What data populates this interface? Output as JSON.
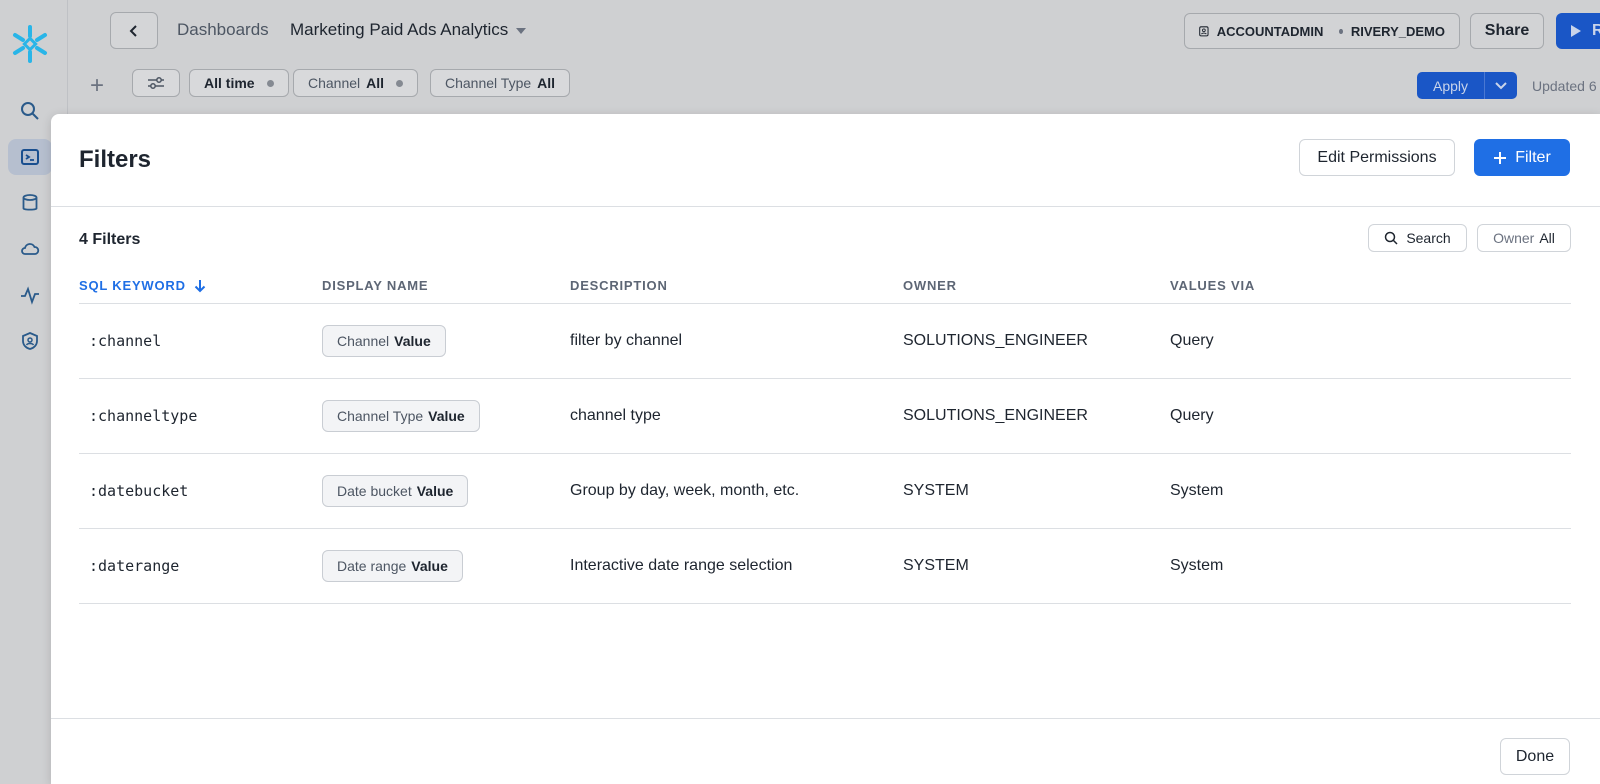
{
  "topbar": {
    "breadcrumb": "Dashboards",
    "dashboard_title": "Marketing Paid Ads Analytics",
    "role": "ACCOUNTADMIN",
    "warehouse": "RIVERY_DEMO",
    "share_label": "Share",
    "run_label": "R"
  },
  "filterbar": {
    "chips": [
      {
        "label": "All time",
        "value": ""
      },
      {
        "label": "Channel",
        "value": "All"
      },
      {
        "label": "Channel Type",
        "value": "All"
      }
    ],
    "apply_label": "Apply",
    "updated_text": "Updated 6"
  },
  "modal": {
    "title": "Filters",
    "edit_permissions_label": "Edit Permissions",
    "add_filter_label": "Filter",
    "count_text": "4 Filters",
    "search_label": "Search",
    "owner_label": "Owner",
    "owner_value": "All",
    "done_label": "Done",
    "columns": [
      "SQL KEYWORD",
      "DISPLAY NAME",
      "DESCRIPTION",
      "OWNER",
      "VALUES VIA"
    ],
    "rows": [
      {
        "keyword": ":channel",
        "display_name": "Channel",
        "display_suffix": "Value",
        "description": "filter by channel",
        "owner": "SOLUTIONS_ENGINEER",
        "values_via": "Query"
      },
      {
        "keyword": ":channeltype",
        "display_name": "Channel Type",
        "display_suffix": "Value",
        "description": "channel type",
        "owner": "SOLUTIONS_ENGINEER",
        "values_via": "Query"
      },
      {
        "keyword": ":datebucket",
        "display_name": "Date bucket",
        "display_suffix": "Value",
        "description": "Group by day, week, month, etc.",
        "owner": "SYSTEM",
        "values_via": "System"
      },
      {
        "keyword": ":daterange",
        "display_name": "Date range",
        "display_suffix": "Value",
        "description": "Interactive date range selection",
        "owner": "SYSTEM",
        "values_via": "System"
      }
    ]
  },
  "icons": {
    "logo": "snowflake-logo",
    "rail": [
      "search-icon",
      "worksheet-icon",
      "database-icon",
      "cloud-icon",
      "activity-icon",
      "shield-icon"
    ]
  },
  "colors": {
    "accent": "#1f6fe5",
    "brand": "#29b5e8"
  }
}
